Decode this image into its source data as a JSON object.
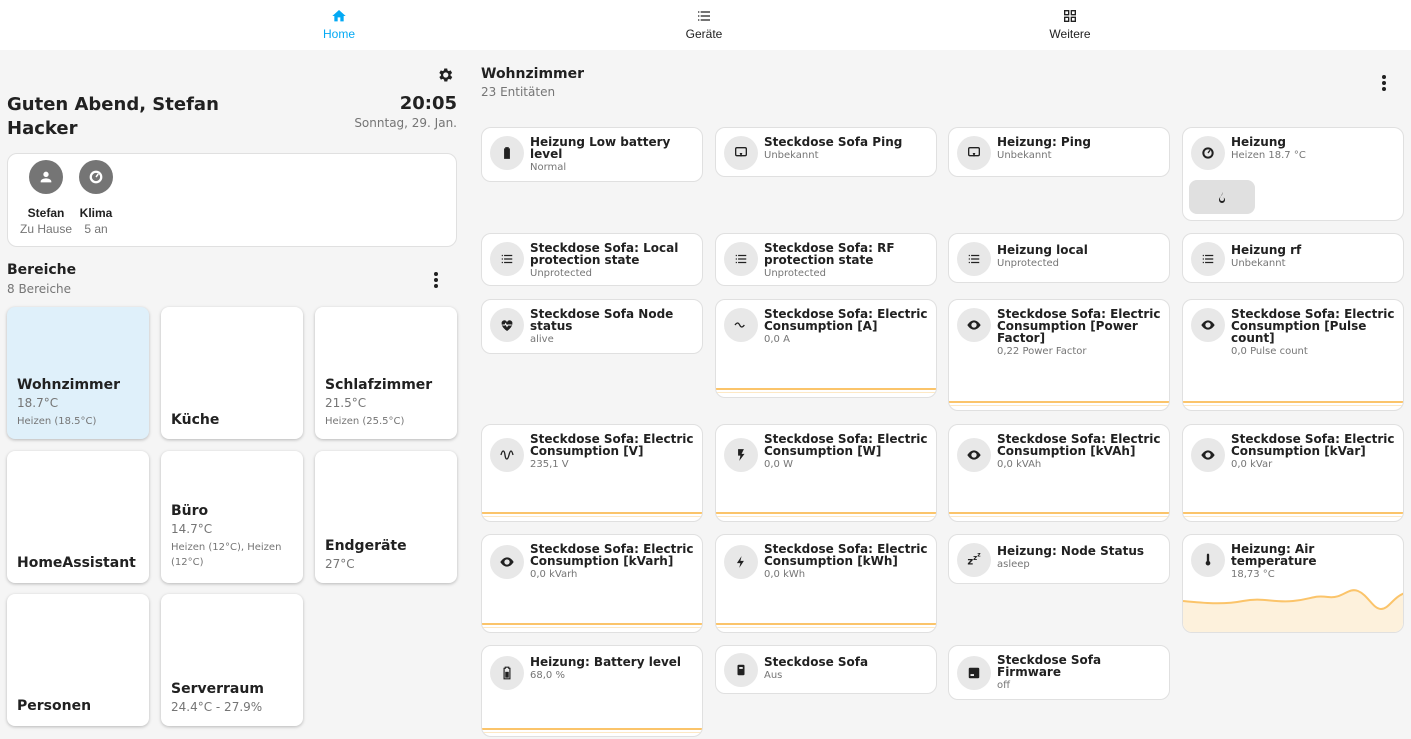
{
  "nav": {
    "tabs": [
      {
        "label": "Home",
        "icon": "home-icon",
        "active": true
      },
      {
        "label": "Geräte",
        "icon": "list-icon",
        "active": false
      },
      {
        "label": "Weitere",
        "icon": "grid-icon",
        "active": false
      }
    ]
  },
  "header": {
    "greeting": "Guten Abend, Stefan Hacker",
    "time": "20:05",
    "date": "Sonntag, 29. Jan."
  },
  "persons": [
    {
      "name": "Stefan",
      "status": "Zu Hause",
      "icon": "person-icon"
    },
    {
      "name": "Klima",
      "status": "5 an",
      "icon": "thermostat-icon"
    }
  ],
  "areas": {
    "title": "Bereiche",
    "subtitle": "8 Bereiche",
    "items": [
      {
        "name": "Wohnzimmer",
        "temp": "18.7°C",
        "heat": "Heizen (18.5°C)",
        "active": true
      },
      {
        "name": "Küche",
        "temp": "",
        "heat": ""
      },
      {
        "name": "Schlafzimmer",
        "temp": "21.5°C",
        "heat": "Heizen (25.5°C)"
      },
      {
        "name": "HomeAssistant",
        "temp": "",
        "heat": ""
      },
      {
        "name": "Büro",
        "temp": "14.7°C",
        "heat": "Heizen (12°C), Heizen (12°C)"
      },
      {
        "name": "Endgeräte",
        "temp": "27°C",
        "heat": ""
      },
      {
        "name": "Personen",
        "temp": "",
        "heat": ""
      },
      {
        "name": "Serverraum",
        "temp": "24.4°C - 27.9%",
        "heat": ""
      }
    ]
  },
  "room": {
    "title": "Wohnzimmer",
    "subtitle": "23 Entitäten"
  },
  "tiles": [
    {
      "name": "Heizung Low battery level",
      "state": "Normal",
      "icon": "battery-icon"
    },
    {
      "name": "Steckdose Sofa Ping",
      "state": "Unbekannt",
      "icon": "ping-icon"
    },
    {
      "name": "Heizung: Ping",
      "state": "Unbekannt",
      "icon": "ping-icon"
    },
    {
      "name": "Heizung",
      "state": "Heizen 18.7 °C",
      "icon": "thermostat-icon",
      "button_icon": "flame-icon"
    },
    {
      "name": "Steckdose Sofa: Local protection state",
      "state": "Unprotected",
      "icon": "list-icon"
    },
    {
      "name": "Steckdose Sofa: RF protection state",
      "state": "Unprotected",
      "icon": "list-icon"
    },
    {
      "name": "Heizung local",
      "state": "Unprotected",
      "icon": "list-icon"
    },
    {
      "name": "Heizung rf",
      "state": "Unbekannt",
      "icon": "list-icon"
    },
    {
      "name": "Steckdose Sofa Node status",
      "state": "alive",
      "icon": "heart-pulse-icon"
    },
    {
      "name": "Steckdose Sofa: Electric Consumption [A]",
      "state": "0,0 A",
      "icon": "current-ac-icon"
    },
    {
      "name": "Steckdose Sofa: Electric Consumption [Power Factor]",
      "state": "0,22 Power Factor",
      "icon": "eye-icon"
    },
    {
      "name": "Steckdose Sofa: Electric Consumption [Pulse count]",
      "state": "0,0 Pulse count",
      "icon": "eye-icon"
    },
    {
      "name": "Steckdose Sofa: Electric Consumption [V]",
      "state": "235,1 V",
      "icon": "sine-wave-icon"
    },
    {
      "name": "Steckdose Sofa: Electric Consumption [W]",
      "state": "0,0 W",
      "icon": "flash-icon"
    },
    {
      "name": "Steckdose Sofa: Electric Consumption [kVAh]",
      "state": "0,0 kVAh",
      "icon": "eye-icon"
    },
    {
      "name": "Steckdose Sofa: Electric Consumption [kVar]",
      "state": "0,0 kVar",
      "icon": "eye-icon"
    },
    {
      "name": "Steckdose Sofa: Electric Consumption [kVarh]",
      "state": "0,0 kVarh",
      "icon": "eye-icon"
    },
    {
      "name": "Steckdose Sofa: Electric Consumption [kWh]",
      "state": "0,0 kWh",
      "icon": "flash-icon"
    },
    {
      "name": "Heizung: Node Status",
      "state": "asleep",
      "icon": "sleep-icon"
    },
    {
      "name": "Heizung: Air temperature",
      "state": "18,73 °C",
      "icon": "thermometer-icon"
    },
    {
      "name": "Heizung: Battery level",
      "state": "68,0 %",
      "icon": "battery-icon"
    },
    {
      "name": "Steckdose Sofa",
      "state": "Aus",
      "icon": "plug-icon"
    },
    {
      "name": "Steckdose Sofa Firmware",
      "state": "off",
      "icon": "firmware-icon"
    }
  ],
  "colors": {
    "accent": "#03a9f4",
    "sensor_line": "#fbc46a",
    "active_area": "#dff0fa"
  }
}
